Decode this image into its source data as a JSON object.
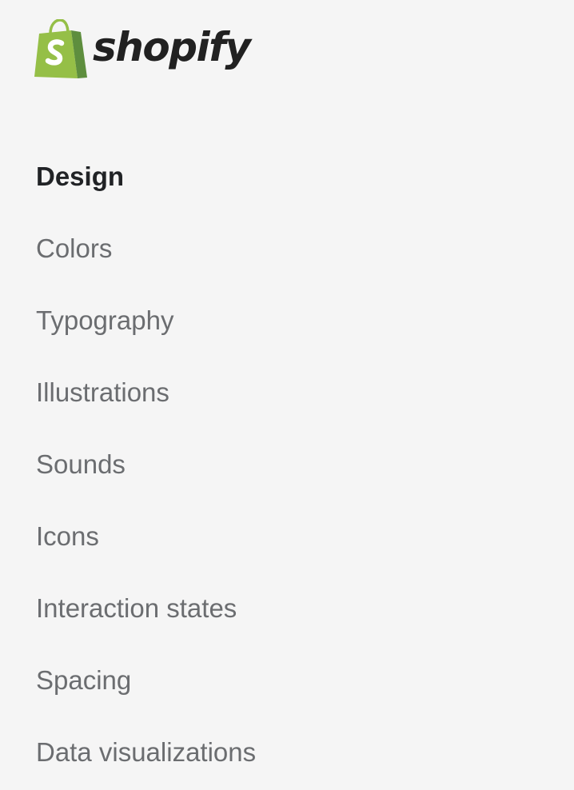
{
  "brand": {
    "name": "shopify",
    "logo_icon": "shopify-bag-icon",
    "colors": {
      "bag_light": "#95bf47",
      "bag_dark": "#5e8e3e",
      "wordmark": "#212121"
    }
  },
  "nav": {
    "heading": "Design",
    "items": [
      {
        "label": "Colors"
      },
      {
        "label": "Typography"
      },
      {
        "label": "Illustrations"
      },
      {
        "label": "Sounds"
      },
      {
        "label": "Icons"
      },
      {
        "label": "Interaction states"
      },
      {
        "label": "Spacing"
      },
      {
        "label": "Data visualizations"
      }
    ]
  },
  "colors": {
    "background": "#f5f5f5",
    "heading_text": "#212326",
    "item_text": "#6b6d70"
  }
}
